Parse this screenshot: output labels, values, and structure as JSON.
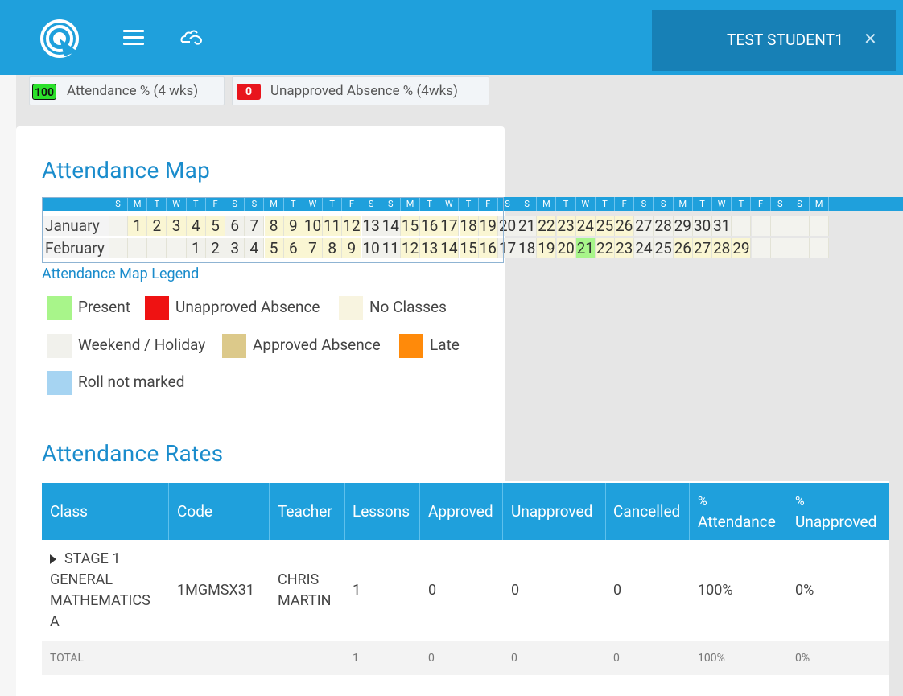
{
  "topbar": {
    "user_name": "TEST STUDENT1",
    "close_glyph": "✕",
    "colors": {
      "bar": "#1fa0dc",
      "user_panel": "#1780b6"
    }
  },
  "stats": [
    {
      "value": "100",
      "label": "Attendance % (4 wks)",
      "badge_color": "#2be02b"
    },
    {
      "value": "0",
      "label": "Unapproved Absence % (4wks)",
      "badge_color": "#e8151d"
    }
  ],
  "attendance_map": {
    "title": "Attendance Map",
    "day_headers": [
      "S",
      "M",
      "T",
      "W",
      "T",
      "F",
      "S",
      "S",
      "M",
      "T",
      "W",
      "T",
      "F",
      "S",
      "S",
      "M",
      "T",
      "W",
      "T",
      "F",
      "S",
      "S",
      "M",
      "T",
      "W",
      "T",
      "F",
      "S",
      "S",
      "M",
      "T",
      "W",
      "T",
      "F",
      "S",
      "S",
      "M"
    ],
    "months": [
      {
        "name": "January",
        "offset": 1,
        "days": 31,
        "states": [
          "n",
          "n",
          "n",
          "n",
          "n",
          "w",
          "w",
          "n",
          "n",
          "n",
          "n",
          "n",
          "w",
          "w",
          "n",
          "n",
          "n",
          "n",
          "n",
          "w",
          "w",
          "n",
          "n",
          "n",
          "n",
          "n",
          "w",
          "w",
          "w",
          "w",
          "w"
        ]
      },
      {
        "name": "February",
        "offset": 4,
        "days": 29,
        "states": [
          "w",
          "w",
          "w",
          "w",
          "n",
          "n",
          "n",
          "n",
          "n",
          "w",
          "w",
          "n",
          "n",
          "n",
          "n",
          "n",
          "w",
          "w",
          "n",
          "n",
          "p",
          "n",
          "n",
          "w",
          "w",
          "n",
          "n",
          "n",
          "n"
        ]
      }
    ],
    "legend_title": "Attendance Map Legend",
    "legend": [
      {
        "label": "Present",
        "color": "#a8f58a"
      },
      {
        "label": "Unapproved Absence",
        "color": "#ef1212"
      },
      {
        "label": "No Classes",
        "color": "#f8f4e0"
      },
      {
        "label": "Weekend / Holiday",
        "color": "#f1f1ec"
      },
      {
        "label": "Approved Absence",
        "color": "#dcc98a"
      },
      {
        "label": "Late",
        "color": "#ff8a0a"
      },
      {
        "label": "Roll not marked",
        "color": "#a6d4f2"
      }
    ]
  },
  "rates": {
    "title": "Attendance Rates",
    "columns": [
      "Class",
      "Code",
      "Teacher",
      "Lessons",
      "Approved",
      "Unapproved",
      "Cancelled",
      "% Attendance",
      "% Unapproved"
    ],
    "column_lines": {
      "pct_attendance": [
        "%",
        "Attendance"
      ],
      "pct_unapproved": [
        "%",
        "Unapproved"
      ]
    },
    "rows": [
      {
        "class_lines": [
          "STAGE 1",
          "GENERAL",
          "MATHEMATICS",
          "A"
        ],
        "code": "1MGMSX31",
        "teacher_lines": [
          "CHRIS",
          "MARTIN"
        ],
        "lessons": "1",
        "approved": "0",
        "unapproved": "0",
        "cancelled": "0",
        "attendance": "100%",
        "unapproved_pct": "0%"
      }
    ],
    "total": {
      "label": "TOTAL",
      "lessons": "1",
      "approved": "0",
      "unapproved": "0",
      "cancelled": "0",
      "attendance": "100%",
      "unapproved_pct": "0%"
    }
  },
  "icons": [
    "logo-icon",
    "menu-icon",
    "cloud-icon",
    "close-icon",
    "expand-caret-icon"
  ]
}
